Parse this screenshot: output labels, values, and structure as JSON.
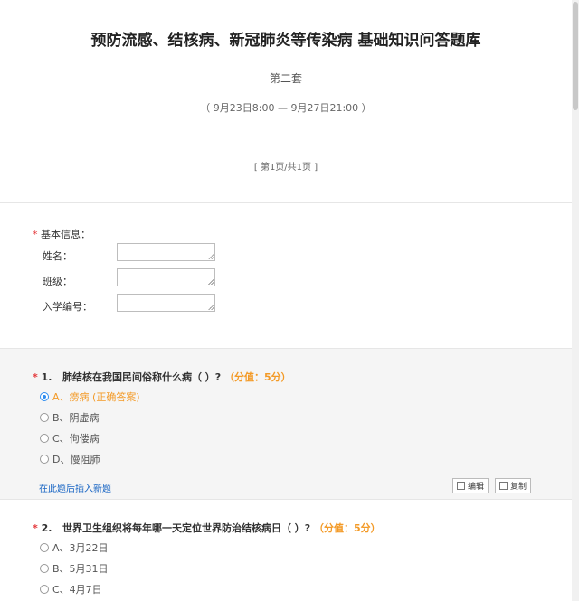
{
  "header": {
    "title": "预防流感、结核病、新冠肺炎等传染病 基础知识问答题库",
    "subtitle": "第二套",
    "time": "（   9月23日8:00 — 9月27日21:00 ）"
  },
  "pager": {
    "text": "[ 第1页/共1页 ]"
  },
  "basic_info": {
    "required_mark": "*",
    "label": "基本信息：",
    "fields": [
      {
        "label": "姓名："
      },
      {
        "label": "班级："
      },
      {
        "label": "入学编号："
      }
    ]
  },
  "questions": [
    {
      "required_mark": "*",
      "number": "1.",
      "text": "肺结核在我国民间俗称什么病（ ）?",
      "score": "（分值：5分）",
      "options": [
        {
          "label": "A、痨病 (正确答案)",
          "selected": true
        },
        {
          "label": "B、阴虚病",
          "selected": false
        },
        {
          "label": "C、佝偻病",
          "selected": false
        },
        {
          "label": "D、慢阻肺",
          "selected": false
        }
      ],
      "insert_link": "在此题后插入新题",
      "edit_label": "编辑",
      "copy_label": "复制"
    },
    {
      "required_mark": "*",
      "number": "2.",
      "text": "世界卫生组织将每年哪一天定位世界防治结核病日（ ）?",
      "score": "（分值：5分）",
      "options": [
        {
          "label": "A、3月22日",
          "selected": false
        },
        {
          "label": "B、5月31日",
          "selected": false
        },
        {
          "label": "C、4月7日",
          "selected": false
        }
      ]
    }
  ]
}
